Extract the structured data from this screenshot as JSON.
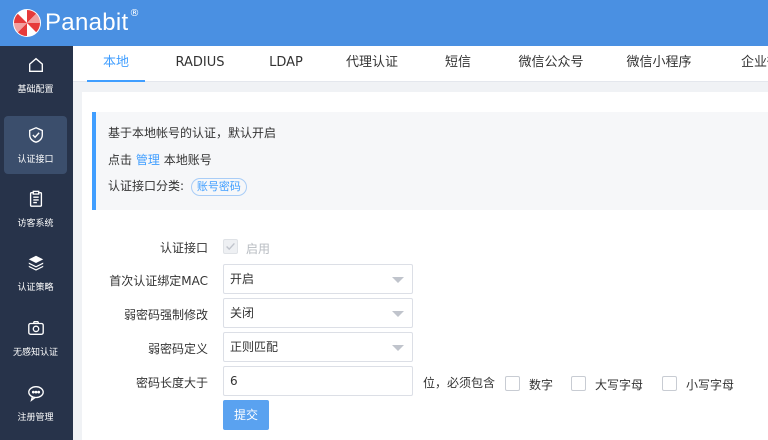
{
  "brand": {
    "name": "Panabit",
    "reg": "®",
    "accent": "#4a90e2",
    "logo_color": "#e63b3b"
  },
  "sidebar": {
    "items": [
      {
        "label": "基础配置",
        "icon": "home-icon"
      },
      {
        "label": "认证接口",
        "icon": "shield-check-icon",
        "active": true
      },
      {
        "label": "访客系统",
        "icon": "clipboard-icon"
      },
      {
        "label": "认证策略",
        "icon": "layers-icon"
      },
      {
        "label": "无感知认证",
        "icon": "camera-icon"
      },
      {
        "label": "注册管理",
        "icon": "chat-icon"
      }
    ]
  },
  "tabs": [
    {
      "label": "本地",
      "active": true
    },
    {
      "label": "RADIUS"
    },
    {
      "label": "LDAP"
    },
    {
      "label": "代理认证"
    },
    {
      "label": "短信"
    },
    {
      "label": "微信公众号"
    },
    {
      "label": "微信小程序"
    },
    {
      "label": "企业微信"
    }
  ],
  "info": {
    "line1": "基于本地帐号的认证，默认开启",
    "line2_prefix": "点击",
    "line2_link": "管理",
    "line2_suffix": "本地账号",
    "line3_label": "认证接口分类:",
    "line3_tag": "账号密码"
  },
  "form": {
    "auth_interface": {
      "label": "认证接口",
      "checkbox_label": "启用"
    },
    "first_bind_mac": {
      "label": "首次认证绑定MAC",
      "value": "开启"
    },
    "weak_pwd_force": {
      "label": "弱密码强制修改",
      "value": "关闭"
    },
    "weak_pwd_def": {
      "label": "弱密码定义",
      "value": "正则匹配"
    },
    "pwd_length": {
      "label": "密码长度大于",
      "value": "6",
      "suffix": "位，必须包含",
      "options": [
        "数字",
        "大写字母",
        "小写字母"
      ]
    },
    "submit_label": "提交"
  }
}
